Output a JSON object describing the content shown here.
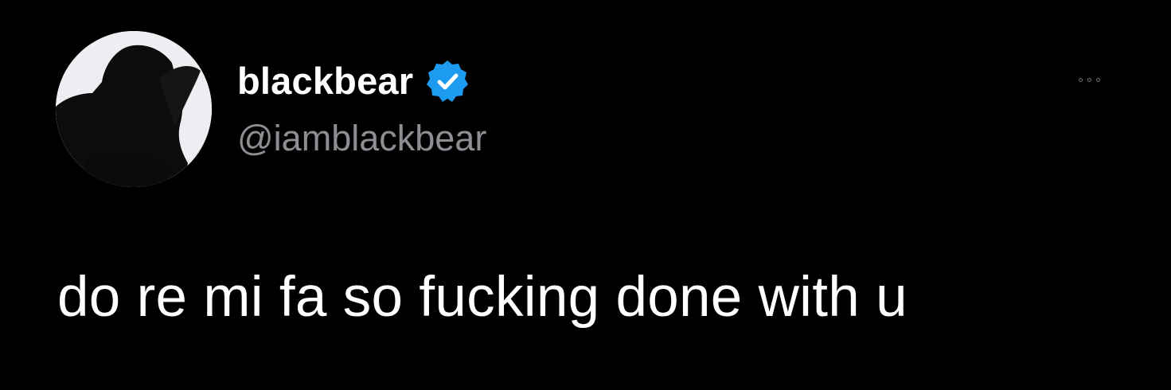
{
  "author": {
    "display_name": "blackbear",
    "handle": "@iamblackbear",
    "verified": true,
    "verified_icon": "verified-badge-icon",
    "verified_color": "#1d9bf0",
    "avatar": "profile-silhouette"
  },
  "menu": {
    "icon": "more-options-icon"
  },
  "tweet": {
    "text": "do re mi fa so fucking done with u"
  },
  "colors": {
    "background": "#000000",
    "primary_text": "#ffffff",
    "secondary_text": "#8b8f94"
  }
}
